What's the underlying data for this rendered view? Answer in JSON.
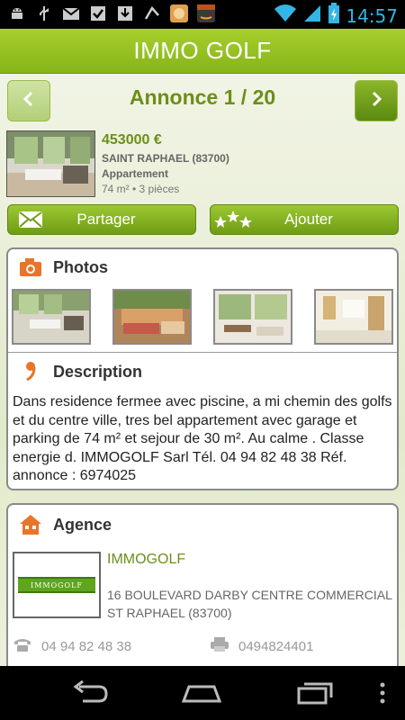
{
  "status_bar": {
    "time": "14:57",
    "icons": [
      "android-debug-icon",
      "usb-icon",
      "gmail-icon",
      "task-check-icon",
      "download-icon",
      "music-icon",
      "avatar-app-icon",
      "amazon-icon",
      "wifi-icon",
      "signal-icon",
      "battery-charging-icon"
    ],
    "accent_color": "#33b5e5"
  },
  "app": {
    "title": "IMMO GOLF",
    "brand_color": "#8bba1f"
  },
  "nav": {
    "title": "Annonce 1 / 20",
    "prev_icon": "chevron-left-icon",
    "next_icon": "chevron-right-icon"
  },
  "listing": {
    "price": "453000 €",
    "city": "SAINT RAPHAEL (83700)",
    "type": "Appartement",
    "size": "74 m² • 3 pièces"
  },
  "actions": {
    "share_label": "Partager",
    "add_label": "Ajouter"
  },
  "photos_section": {
    "title": "Photos",
    "count": 4
  },
  "description_section": {
    "title": "Description",
    "text": "Dans residence fermee avec piscine, a mi chemin des golfs et du centre ville, tres bel appartement avec garage et parking de 74 m² et sejour de 30 m². Au calme . Classe energie d. IMMOGOLF Sarl Tél. 04 94 82 48 38 Réf. annonce : 6974025"
  },
  "agency_section": {
    "title": "Agence",
    "logo_text": "IMMOGOLF",
    "name": "IMMOGOLF",
    "address": "16 BOULEVARD DARBY CENTRE COMMERCIAL ST RAPHAEL (83700)",
    "phone": "04 94 82 48 38",
    "fax": "0494824401"
  }
}
